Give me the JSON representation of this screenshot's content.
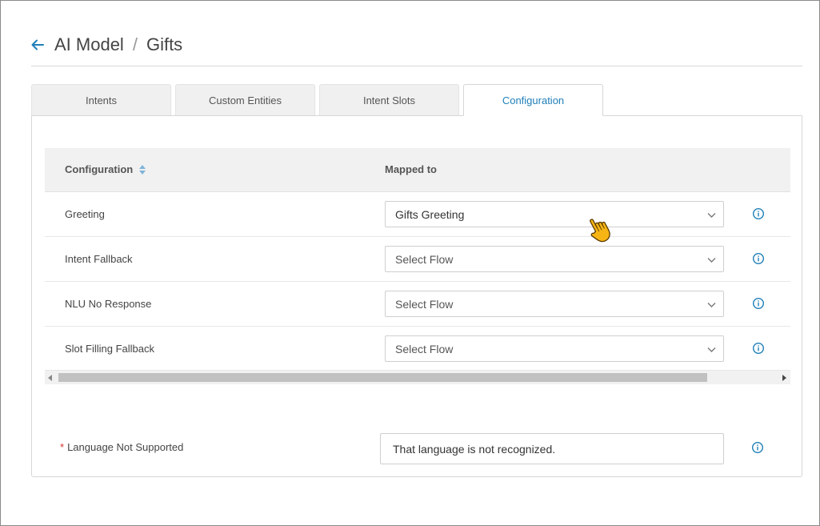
{
  "breadcrumb": {
    "parent": "AI Model",
    "separator": "/",
    "current": "Gifts"
  },
  "tabs": [
    {
      "label": "Intents",
      "active": false
    },
    {
      "label": "Custom Entities",
      "active": false
    },
    {
      "label": "Intent Slots",
      "active": false
    },
    {
      "label": "Configuration",
      "active": true
    }
  ],
  "table": {
    "headers": {
      "configuration": "Configuration",
      "mapped_to": "Mapped to"
    },
    "rows": [
      {
        "label": "Greeting",
        "value": "Gifts Greeting"
      },
      {
        "label": "Intent Fallback",
        "value": "Select Flow"
      },
      {
        "label": "NLU No Response",
        "value": "Select Flow"
      },
      {
        "label": "Slot Filling Fallback",
        "value": "Select Flow"
      }
    ]
  },
  "language": {
    "required_mark": "*",
    "label": "Language Not Supported",
    "value": "That language is not recognized."
  },
  "icons": {
    "back": "arrow-left-icon",
    "sort": "sort-icon",
    "chevron": "chevron-down-icon",
    "info": "info-icon",
    "cursor": "hand-pointer-icon"
  },
  "colors": {
    "accent": "#1f7fb8",
    "required": "#d9342b",
    "header_bg": "#f1f1f1"
  }
}
